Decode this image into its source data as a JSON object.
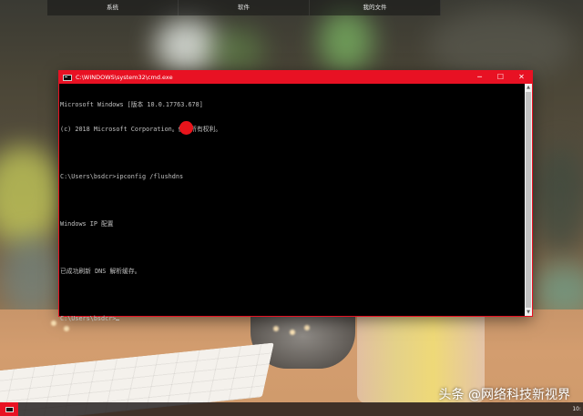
{
  "topbar": {
    "tabs": [
      "系统",
      "软件",
      "我的文件"
    ]
  },
  "cmd_window": {
    "title": "C:\\WINDOWS\\system32\\cmd.exe",
    "controls": {
      "minimize": "─",
      "maximize": "☐",
      "close": "✕"
    },
    "console_lines": [
      "Microsoft Windows [版本 10.0.17763.678]",
      "(c) 2018 Microsoft Corporation。保留所有权利。",
      "",
      "C:\\Users\\bsdcr>ipconfig /flushdns",
      "",
      "Windows IP 配置",
      "",
      "已成功刷新 DNS 解析缓存。",
      "",
      "C:\\Users\\bsdcr>"
    ]
  },
  "scrollbar": {
    "up": "▲",
    "down": "▼"
  },
  "taskbar": {
    "clock": "10:"
  },
  "watermark": "头条 @网络科技新视界",
  "colors": {
    "accent": "#e81123",
    "console_bg": "#000000",
    "console_fg": "#c0c0c0",
    "red_dot": "#e8141b"
  }
}
